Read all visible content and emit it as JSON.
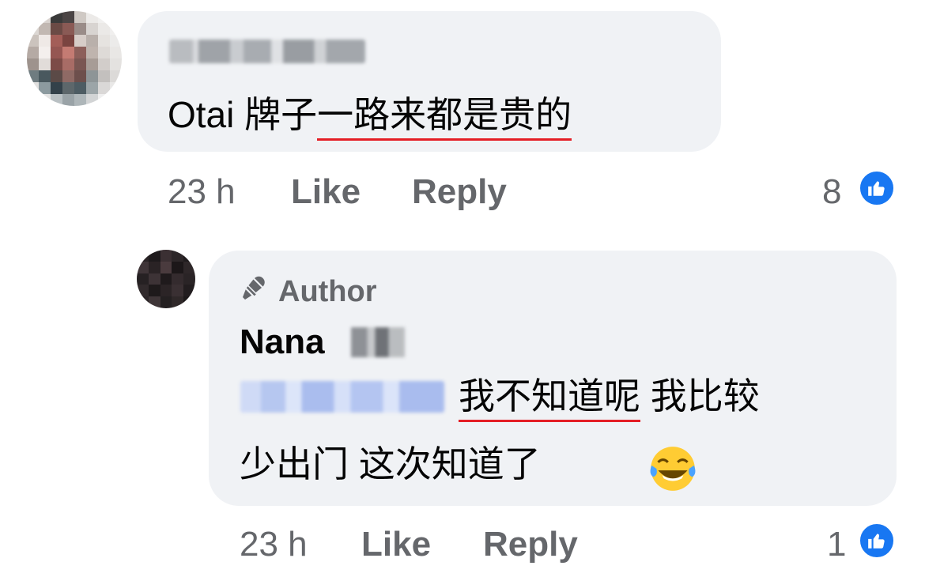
{
  "comment1": {
    "author_blurred": true,
    "text_plain": "Otai 牌子",
    "text_underlined": "一路来都是贵的",
    "time": "23 h",
    "like_label": "Like",
    "reply_label": "Reply",
    "reaction_count": "8"
  },
  "reply1": {
    "badge_label": "Author",
    "author_name": "Nana",
    "mention_blurred": true,
    "text_underlined": "我不知道呢",
    "text_after": " 我比较",
    "text_line2": "少出门 这次知道了",
    "time": "23 h",
    "like_label": "Like",
    "reply_label": "Reply",
    "reaction_count": "1"
  },
  "colors": {
    "bubble": "#f0f2f5",
    "meta_text": "#65676b",
    "like_blue": "#1877f2",
    "underline_red": "#e41e25"
  },
  "icons": {
    "like": "thumbs-up-icon",
    "author": "microphone-icon",
    "emoji": "tears-of-joy-emoji"
  }
}
